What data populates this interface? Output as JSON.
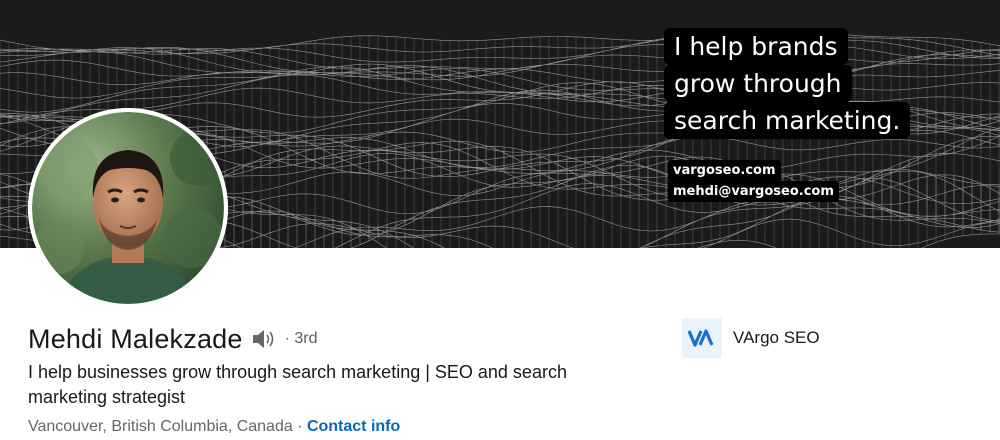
{
  "banner": {
    "tagline_lines": [
      "I help brands",
      "grow through",
      "search marketing."
    ],
    "website": "vargoseo.com",
    "email": "mehdi@vargoseo.com"
  },
  "profile": {
    "name": "Mehdi Malekzade",
    "degree": "· 3rd",
    "headline": "I help businesses grow through search marketing | SEO and search marketing strategist",
    "location": "Vancouver, British Columbia, Canada",
    "separator": " · ",
    "contact_link": "Contact info"
  },
  "company": {
    "name": "VArgo SEO",
    "logo_text": "VA"
  },
  "colors": {
    "link": "#0a66c2",
    "banner_bg": "#1b1b1b",
    "company_logo_bg": "#eaf3fb"
  },
  "icons": {
    "speaker": "speaker-icon",
    "company_logo": "vargo-logo-icon"
  }
}
